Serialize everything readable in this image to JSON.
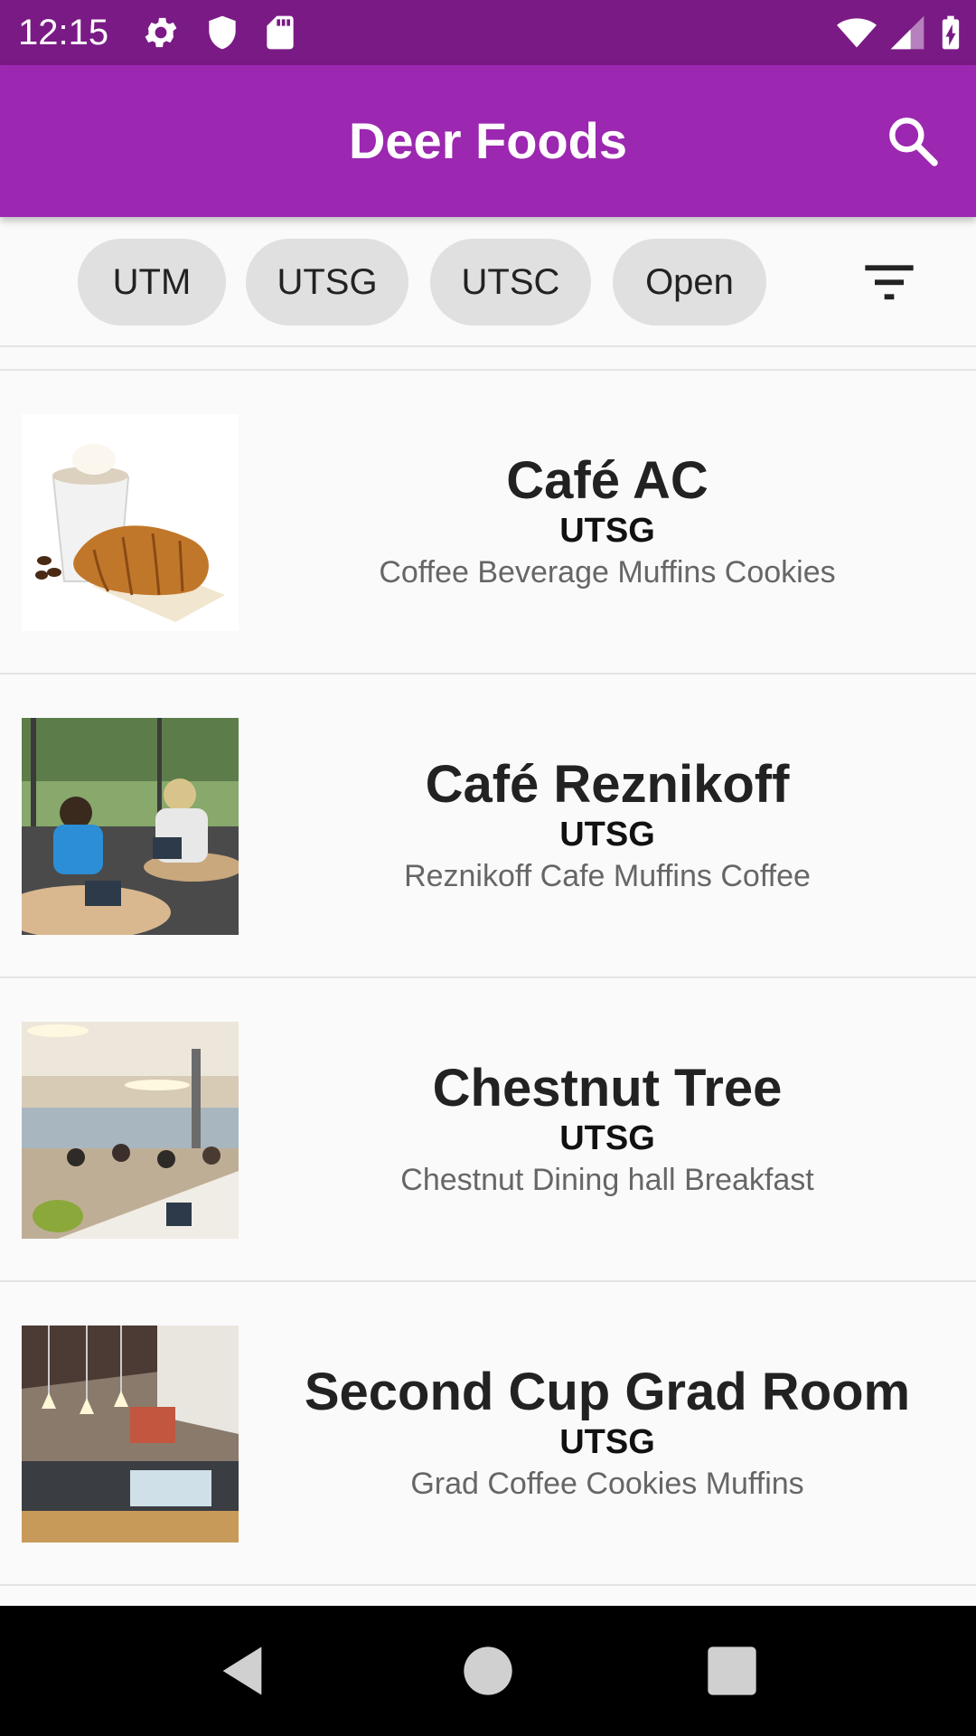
{
  "status_bar": {
    "time": "12:15",
    "left_icons": [
      "gear-icon",
      "shield-icon",
      "sd-card-icon"
    ],
    "right_icons": [
      "wifi-icon",
      "cell-signal-icon",
      "battery-charging-icon"
    ]
  },
  "app_bar": {
    "title": "Deer Foods",
    "search_icon": "search-icon",
    "color": "#9c27b0",
    "status_color": "#7a1a85"
  },
  "filters": {
    "chips": [
      {
        "label": "UTM"
      },
      {
        "label": "UTSG"
      },
      {
        "label": "UTSC"
      },
      {
        "label": "Open"
      }
    ],
    "filter_icon": "filter-list-icon"
  },
  "restaurants": [
    {
      "name": "Café AC",
      "campus": "UTSG",
      "tags": [
        "Coffee",
        "Beverage",
        "Muffins",
        "Cookies"
      ],
      "image": "coffee-croissant-photo"
    },
    {
      "name": "Café Reznikoff",
      "campus": "UTSG",
      "tags": [
        "Reznikoff",
        "Cafe",
        "Muffins",
        "Coffee"
      ],
      "image": "outdoor-cafe-photo"
    },
    {
      "name": "Chestnut Tree",
      "campus": "UTSG",
      "tags": [
        "Chestnut",
        "Dining hall",
        "Breakfast"
      ],
      "image": "dining-hall-photo"
    },
    {
      "name": "Second Cup Grad Room",
      "campus": "UTSG",
      "tags": [
        "Grad",
        "Coffee",
        "Cookies",
        "Muffins"
      ],
      "image": "coffee-shop-counter-photo"
    }
  ],
  "nav_bar": {
    "back_icon": "back-triangle-icon",
    "home_icon": "home-circle-icon",
    "recents_icon": "recents-square-icon"
  }
}
